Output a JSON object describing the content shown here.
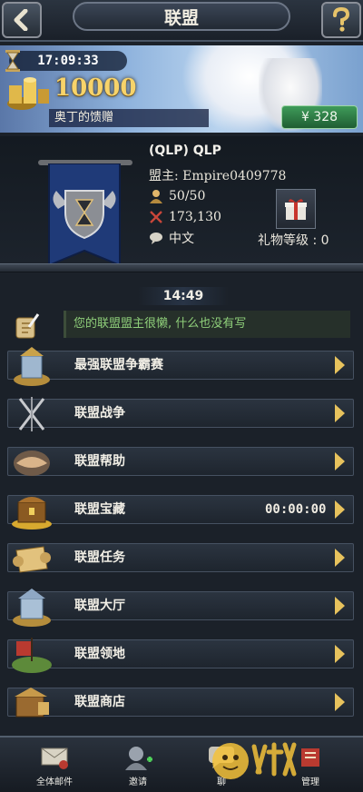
{
  "header": {
    "title": "联盟",
    "back_icon": "chevron-left-icon",
    "help_icon": "question-mark-icon"
  },
  "banner": {
    "countdown": "17:09:33",
    "amount": "10000",
    "subtitle": "奥丁的馈赠",
    "price": "¥ 328"
  },
  "alliance": {
    "name": "(QLP) QLP",
    "leader": "盟主: Empire0409778",
    "members": "50/50",
    "power": "173,130",
    "language": "中文",
    "gift_level": "礼物等级 : 0"
  },
  "chat": {
    "time": "14:49",
    "message": "您的联盟盟主很懒, 什么也没有写"
  },
  "menu": [
    {
      "label": "最强联盟争霸赛",
      "icon": "tower-icon"
    },
    {
      "label": "联盟战争",
      "icon": "crossed-swords-icon"
    },
    {
      "label": "联盟帮助",
      "icon": "handshake-icon"
    },
    {
      "label": "联盟宝藏",
      "icon": "treasure-chest-icon",
      "timer": "00:00:00"
    },
    {
      "label": "联盟任务",
      "icon": "scroll-icon"
    },
    {
      "label": "联盟大厅",
      "icon": "hall-icon"
    },
    {
      "label": "联盟领地",
      "icon": "territory-icon"
    },
    {
      "label": "联盟商店",
      "icon": "shop-icon"
    }
  ],
  "bottom_tabs": [
    {
      "label": "全体邮件",
      "icon": "mail-icon"
    },
    {
      "label": "邀请",
      "icon": "invite-icon"
    },
    {
      "label": "聊",
      "icon": "chat-icon"
    },
    {
      "label": "管理",
      "icon": "manage-icon"
    }
  ],
  "colors": {
    "accent_gold": "#f7d36a",
    "chat_green": "#8fcf7a",
    "buy_green": "#3f9b5a",
    "flag_blue": "#1f3a78"
  }
}
